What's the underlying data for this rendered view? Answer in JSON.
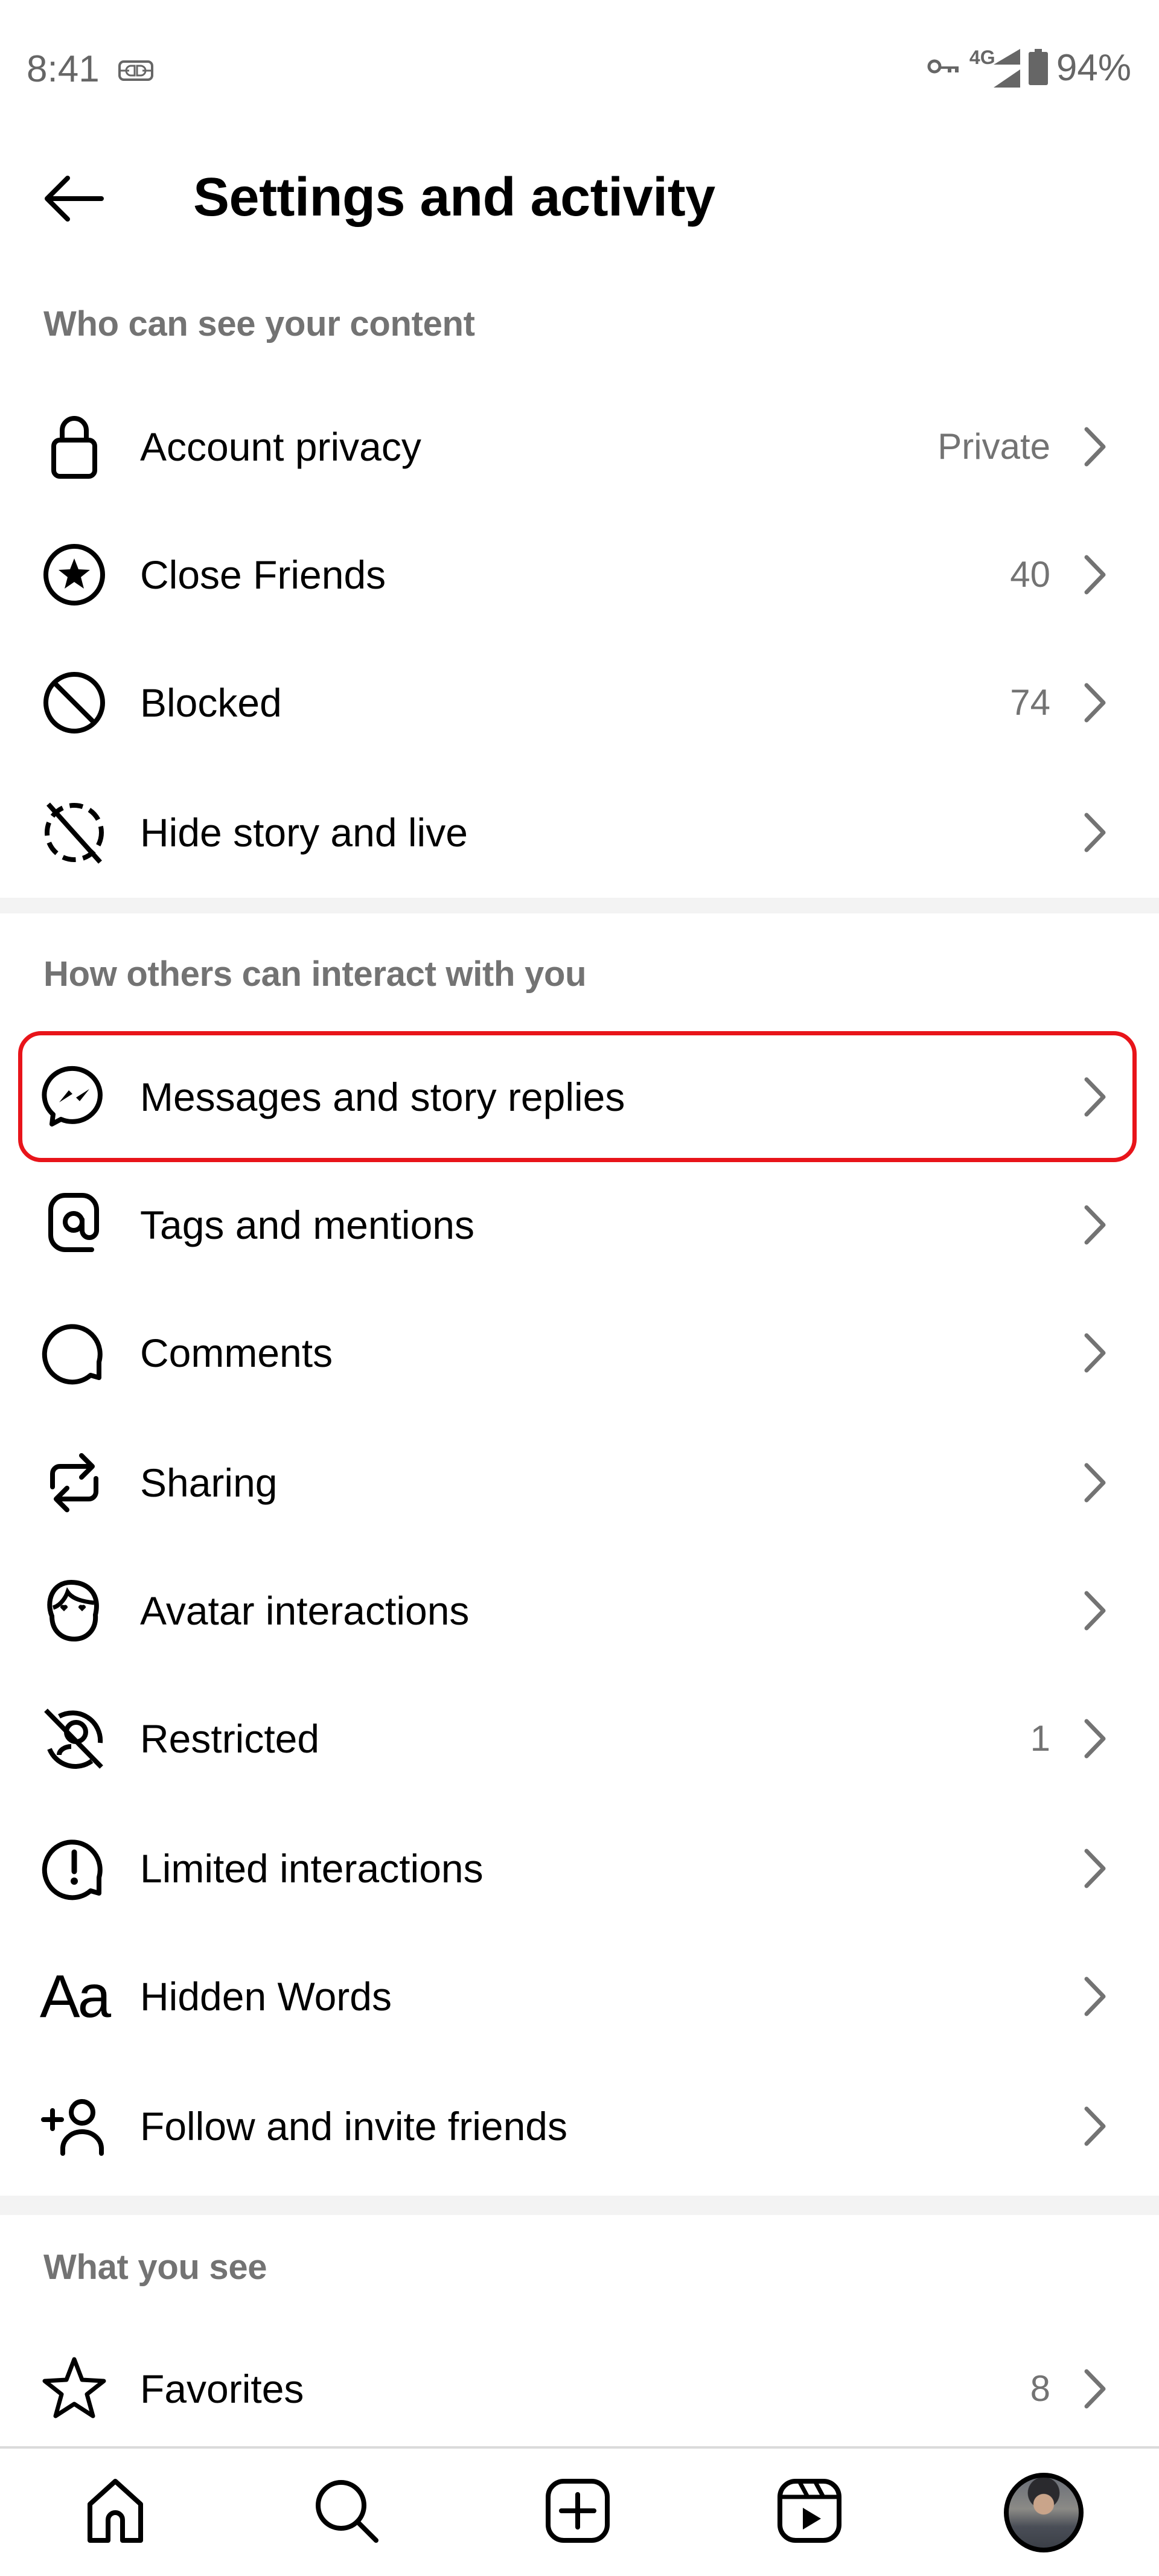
{
  "status_bar": {
    "time": "8:41",
    "left_icons": [
      "sim-card-icon"
    ],
    "right_icons": [
      "vpn-key-icon",
      "signal-4g-icon",
      "battery-icon"
    ],
    "network_label": "4G",
    "battery_percent": "94%"
  },
  "header": {
    "back_icon": "arrow-left-icon",
    "title": "Settings and activity"
  },
  "sections": [
    {
      "title": "Who can see your content",
      "items": [
        {
          "label": "Account privacy",
          "value": "Private",
          "icon": "lock-icon"
        },
        {
          "label": "Close Friends",
          "value": "40",
          "icon": "star-circle-icon"
        },
        {
          "label": "Blocked",
          "value": "74",
          "icon": "blocked-icon"
        },
        {
          "label": "Hide story and live",
          "value": "",
          "icon": "hide-story-icon"
        }
      ]
    },
    {
      "title": "How others can interact with you",
      "items": [
        {
          "label": "Messages and story replies",
          "value": "",
          "icon": "messenger-icon",
          "highlighted": true
        },
        {
          "label": "Tags and mentions",
          "value": "",
          "icon": "at-sign-icon"
        },
        {
          "label": "Comments",
          "value": "",
          "icon": "comment-icon"
        },
        {
          "label": "Sharing",
          "value": "",
          "icon": "share-arrows-icon"
        },
        {
          "label": "Avatar interactions",
          "value": "",
          "icon": "avatar-face-icon"
        },
        {
          "label": "Restricted",
          "value": "1",
          "icon": "restricted-icon"
        },
        {
          "label": "Limited interactions",
          "value": "",
          "icon": "limited-interactions-icon"
        },
        {
          "label": "Hidden Words",
          "value": "",
          "icon": "text-aa-icon"
        },
        {
          "label": "Follow and invite friends",
          "value": "",
          "icon": "add-person-icon"
        }
      ]
    },
    {
      "title": "What you see",
      "items": [
        {
          "label": "Favorites",
          "value": "8",
          "icon": "star-outline-icon"
        }
      ]
    }
  ],
  "highlight_color": "#e8141a",
  "bottom_nav": {
    "items": [
      {
        "name": "home",
        "icon": "home-icon"
      },
      {
        "name": "search",
        "icon": "search-icon"
      },
      {
        "name": "create",
        "icon": "plus-square-icon"
      },
      {
        "name": "reels",
        "icon": "reels-icon"
      },
      {
        "name": "profile",
        "icon": "profile-avatar"
      }
    ]
  }
}
